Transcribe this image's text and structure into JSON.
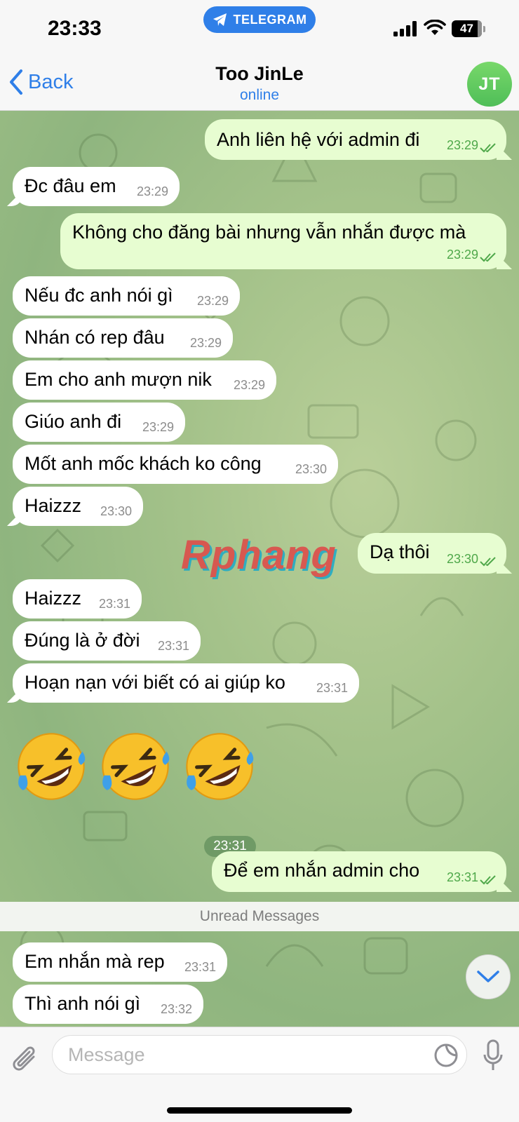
{
  "status_bar": {
    "time": "23:33",
    "app_pill": "TELEGRAM",
    "battery": "47"
  },
  "header": {
    "back_label": "Back",
    "title": "Too JinLe",
    "status": "online",
    "avatar_initials": "JT"
  },
  "messages": [
    {
      "text": "Anh liên hệ với admin đi",
      "time": "23:29",
      "dir": "out"
    },
    {
      "text": "Đc đâu em",
      "time": "23:29",
      "dir": "in"
    },
    {
      "text": "Không cho đăng bài nhưng vẫn nhắn được mà",
      "time": "23:29",
      "dir": "out"
    },
    {
      "text": "Nếu đc anh nói gì",
      "time": "23:29",
      "dir": "in"
    },
    {
      "text": "Nhán có rep đâu",
      "time": "23:29",
      "dir": "in"
    },
    {
      "text": "Em cho anh mượn nik",
      "time": "23:29",
      "dir": "in"
    },
    {
      "text": "Giúo anh đi",
      "time": "23:29",
      "dir": "in"
    },
    {
      "text": "Mốt anh mốc khách ko công",
      "time": "23:30",
      "dir": "in"
    },
    {
      "text": "Haizzz",
      "time": "23:30",
      "dir": "in"
    },
    {
      "text": "Dạ thôi",
      "time": "23:30",
      "dir": "out"
    },
    {
      "text": "Haizzz",
      "time": "23:31",
      "dir": "in"
    },
    {
      "text": "Đúng là ở đời",
      "time": "23:31",
      "dir": "in"
    },
    {
      "text": "Hoạn nạn với biết có ai giúp ko",
      "time": "23:31",
      "dir": "in"
    },
    {
      "text": "Để em nhắn admin cho",
      "time": "23:31",
      "dir": "out"
    },
    {
      "text": "Em nhắn mà rep",
      "time": "23:31",
      "dir": "in"
    },
    {
      "text": "Thì anh nói gì",
      "time": "23:32",
      "dir": "in"
    }
  ],
  "emoji_message": {
    "emoji": [
      "rolling-on-floor-laughing",
      "rolling-on-floor-laughing",
      "rolling-on-floor-laughing"
    ],
    "time": "23:31"
  },
  "unread_divider": "Unread Messages",
  "watermark": "Rphang",
  "input": {
    "placeholder": "Message"
  },
  "colors": {
    "accent": "#2f7fe8",
    "outgoing_bubble": "#e7fdd1",
    "incoming_bubble": "#ffffff",
    "read_ticks": "#4fa84a",
    "avatar": "#5cc85e"
  }
}
